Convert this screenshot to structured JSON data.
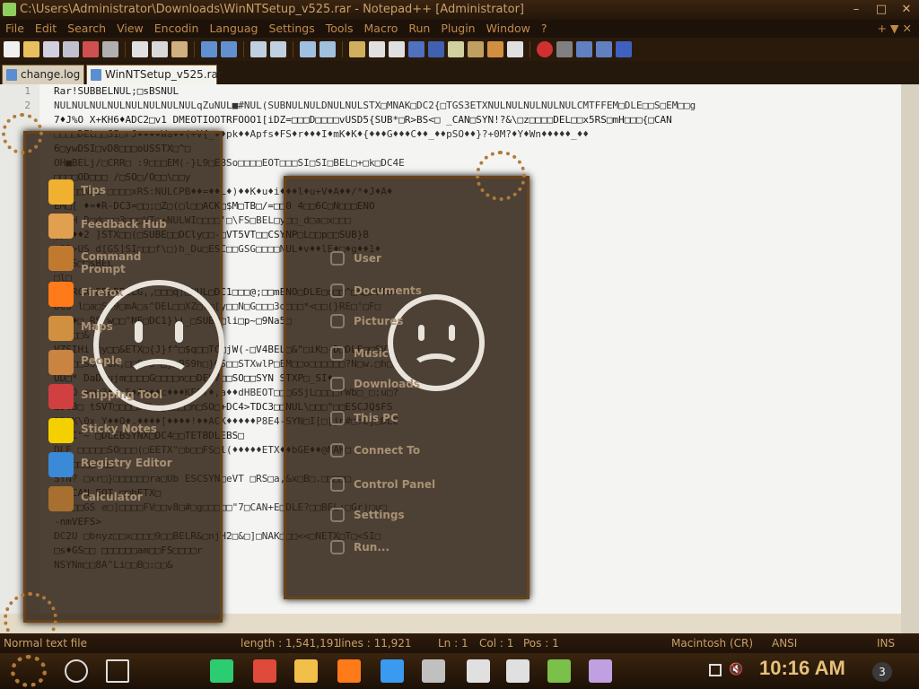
{
  "window": {
    "title": "C:\\Users\\Administrator\\Downloads\\WinNTSetup_v525.rar - Notepad++ [Administrator]",
    "controls": [
      "–",
      "□",
      "✕"
    ]
  },
  "menu": {
    "items": [
      "File",
      "Edit",
      "Search",
      "View",
      "Encodin",
      "Languag",
      "Settings",
      "Tools",
      "Macro",
      "Run",
      "Plugin",
      "Window",
      "?"
    ],
    "right": "+ ▼ ✕"
  },
  "tabs": [
    {
      "label": "change.log",
      "active": false
    },
    {
      "label": "WinNTSetup_v525.rar",
      "active": true
    }
  ],
  "editor": {
    "line_numbers": [
      "1",
      "2"
    ],
    "lines": [
      "Rar!SUBBELNUL;□sBSNUL",
      "NULNULNULNULNULNULNULNULqZuNUL■#NUL(SUBNULNULDNULNULSTX□MNAK□DC2{□TGS3ETXNULNULNULNULNULCMTFFEM□DLE□□S□EM□□g",
      "7♦J%O X+KH6♦ADC2□v1 DMEOTIOOTRFOOO1[iDZ=□□□D□□□□vUSD5{SUB*□R>BS<□ _CAN□SYN!?&\\□z□□□□DEL□□x5RS□mH□□□{□CAN",
      "□□□□DEL□□SI□rJ♦♦♦♦Wa♦♦(+V{_♦♦pk♦♦Apfs♦FS♦r♦♦♦I♦mK♦K♦{♦♦♦G♦♦♦C♦♦_♦♦pSO♦♦}?+0M?♦Y♦Wn♦♦♦♦♦_♦♦",
      "6□ywDSI□vD8□□□oUSSTX□^□",
      "OH■BELj/□CRR□ :9□□□EM(-}L9□EBSo□□□□EOT□□□SI□SI□BEL□+□k□DC4E",
      "□□□□OD□□□ /□SO□/O□□\\□□y",
      "NO2□□NUL □□□□xRS:NULCPB♦♦=♦♦L♦)♦♦K♦u♦i♦♦♦l♦u+V♦A♦♦/*♦J♦A♦",
      "EM□[ ♦=♦R-DC3=□□;□Z□(□l□□ACK□$M□TB□/=□□0 4□□6C□N□□□ENO",
      "SYNH R□d□□□3□□□VT□+NULWI□□□□'□\\FS□BEL□y□□_d□a□x□□□",
      "@p&♦♦2 ]STX□□(□SUBE□□DCly□□-□VT5VT□□CSYNP□L□□p□□SUB}B",
      "*BD>US  d[GS]SI□□□f\\□)h_Du□ESC□□GSG□□□□NUL♦v♦♦lE♦□♦g♦♦1♦",
      "*B□S□□sBEL",
      "□l□",
      "DCIRCA  BELRBELG,,□□□q;□NUL□DC1□□□@;□□mENO□DLE□o□□^□%□&VTbr",
      "DC3  l□a□Si9□mA□s^DEL□□XZ□f□[y□□N□G□□□3d□□□*<□□(}RE□'□F□",
      "R^/♦□ RS w□□\"NE□DC1})i_□SUB□□li□p~□9Na5□",
      "SO!□□&",
      "VZSIHi  □y□□&ETX□{J}f^□$q□□TC□jW(-□V4BEL□&\"□iK□-D□DLE□□SVT",
      "0Q?□□SUB  OX,□□PFS □j□BS9h□}GS□□STXwlP□EM□□o□□□□□□?N□w.□h□P",
      "UD□*  DaDdujm□□□□G□□□□n□□DEL7□□SO□□SYN    STXP□_SI♦",
      "□;SO  ♦□□3♦♦.5♦Ac♦♦c♦♦♦KEOT♦,a♦♦dHBEOT□□□GSjL□□□□rWb□_□;u□?",
      "EDC3□  tSVT□□□□DEL g□□□□n□SO□+DC4>TDC3□□NUL\\□□□\"□□ESCJQ$FS",
      "1DiK\\0x  Y♦♦Q♦.♦♦♦♦[♦♦♦♦!♦♦ACK♦♦♦♦♦P8E4-SYN□I[□[jn#□:Ej□DLE",
      "□♦□C\"~  □DLEBSYNX□DC4□□TETBDLEBS□",
      "DLE  □□□□□SO□□□(□EETX\"□b□□FS□l(♦♦♦♦♦ETX♦♦bGE♦♦@NAK□",
      "DCl□□□□l□□",
      "SYN?  □xr□}□□□□□□ra□Ub  ESCSYN□eVT □RS□a,&x□B□.□□□□□",
      "  □rJCAN EOT □□hETX□",
      "ACK□□GS  e□]□□□□FV□□v8□#□g□□□□□\"7□CAN+E□DLE?□□BEL:□Gr)□u□",
      "-nmVEFS>  ",
      "DC2U  □bnyz□□x□□□□9□□BELR&□njH2□&□]□NAK□□□<<□NETX□T□<SI□",
      "□s♦GS□□  □□□□□□am□□FS□□□□r",
      "NSYNm□□8A\"Li□□B□:□□&"
    ]
  },
  "start_menu_left": {
    "items": [
      {
        "label": "Tips",
        "icon": "lightbulb-icon",
        "color": "#f0b030"
      },
      {
        "label": "Feedback Hub",
        "icon": "feedback-person-icon",
        "color": "#e0a050"
      },
      {
        "label": "Command\nPrompt",
        "icon": "terminal-icon",
        "color": "#c07a30"
      },
      {
        "label": "Firefox",
        "icon": "firefox-icon",
        "color": "#ff7a18"
      },
      {
        "label": "Maps",
        "icon": "maps-icon",
        "color": "#d09040"
      },
      {
        "label": "People",
        "icon": "people-icon",
        "color": "#c88440"
      },
      {
        "label": "Snipping Tool",
        "icon": "scissors-icon",
        "color": "#d04040"
      },
      {
        "label": "Sticky Notes",
        "icon": "sticky-note-icon",
        "color": "#f5d000"
      },
      {
        "label": "Registry Editor",
        "icon": "registry-icon",
        "color": "#3a8ad8"
      },
      {
        "label": "Calculator",
        "icon": "calculator-icon",
        "color": "#a87030"
      }
    ]
  },
  "start_menu_right": {
    "items": [
      {
        "label": "User",
        "icon": "user-icon"
      },
      {
        "label": "Documents",
        "icon": "document-icon"
      },
      {
        "label": "Pictures",
        "icon": "picture-icon"
      },
      {
        "label": "Music",
        "icon": "music-icon"
      },
      {
        "label": "Downloads",
        "icon": "download-icon"
      },
      {
        "label": "This PC",
        "icon": "monitor-icon"
      },
      {
        "label": "Connect To",
        "icon": "connect-icon"
      },
      {
        "label": "Control Panel",
        "icon": "control-panel-icon"
      },
      {
        "label": "Settings",
        "icon": "gear-icon"
      },
      {
        "label": "Run...",
        "icon": "run-icon"
      }
    ]
  },
  "status": {
    "file_type": "Normal text file",
    "length": "length : 1,541,191",
    "lines": "lines : 11,921",
    "ln": "Ln : 1",
    "col": "Col : 1",
    "pos": "Pos : 1",
    "eol": "Macintosh (CR)",
    "encoding": "ANSI",
    "mode": "INS"
  },
  "taskbar": {
    "clock": "10:16 AM",
    "notification_count": "3",
    "apps": [
      {
        "name": "cortana-icon",
        "color": "#dddddd"
      },
      {
        "name": "task-view-icon",
        "color": "#dddddd"
      },
      {
        "name": "chat-app-icon",
        "color": "#2ecc71"
      },
      {
        "name": "chrome-icon",
        "color": "#e04a3a"
      },
      {
        "name": "file-explorer-icon",
        "color": "#f2c04a"
      },
      {
        "name": "firefox-icon",
        "color": "#ff7a18"
      },
      {
        "name": "ie-icon",
        "color": "#3a9af0"
      },
      {
        "name": "theater-icon",
        "color": "#c0c0c0"
      },
      {
        "name": "people-share-icon",
        "color": "#e0e0e0"
      },
      {
        "name": "settings-gear-icon",
        "color": "#e0e0e0"
      },
      {
        "name": "chart-app-icon",
        "color": "#7ac04a"
      },
      {
        "name": "image-tool-icon",
        "color": "#c0a0e0"
      }
    ]
  }
}
